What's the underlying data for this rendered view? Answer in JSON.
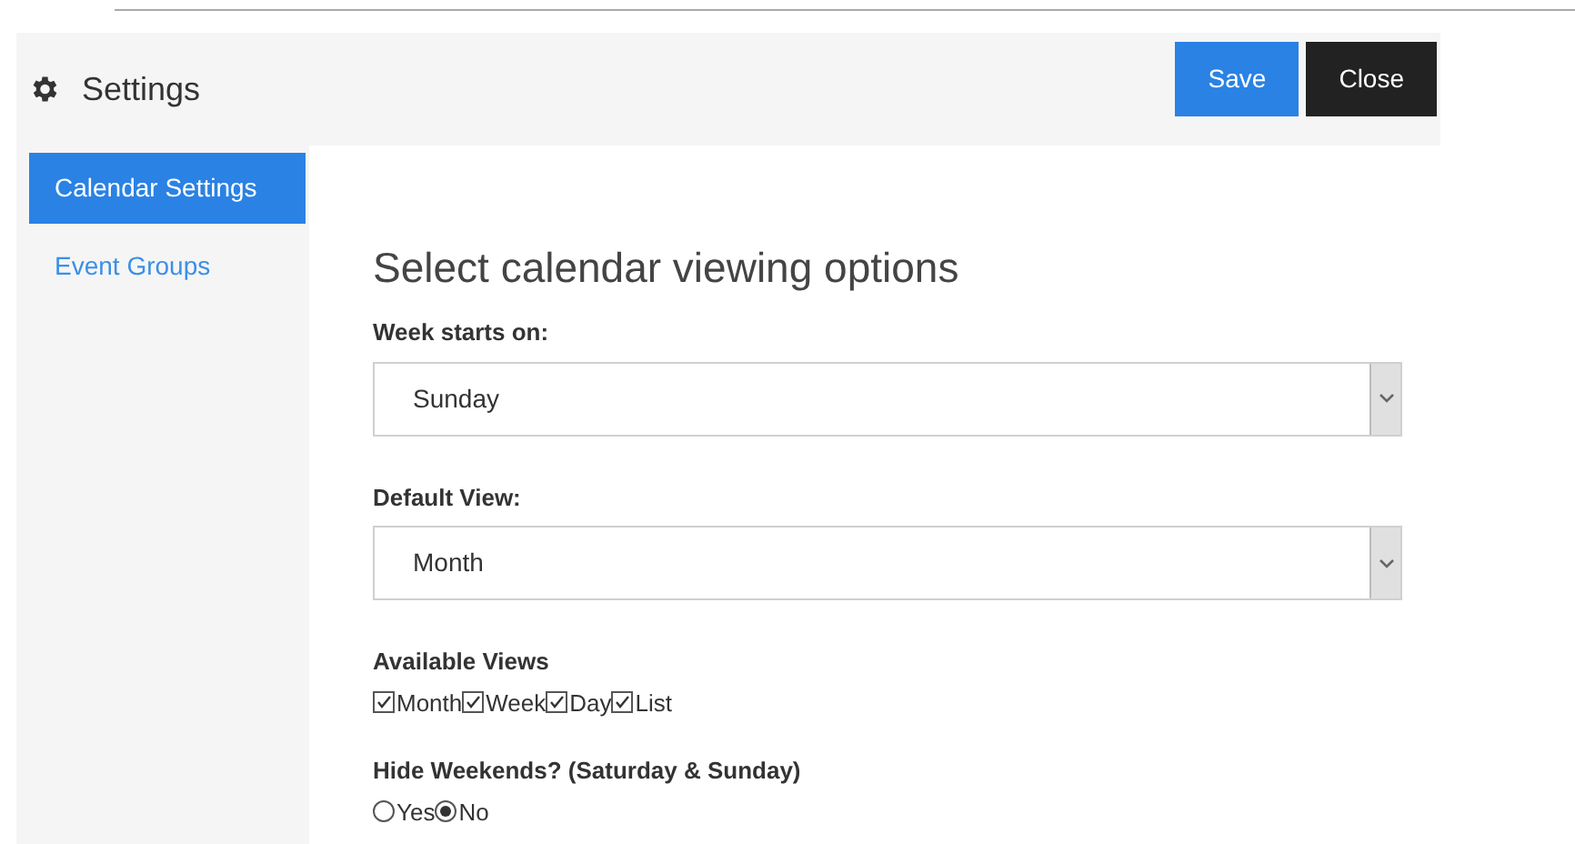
{
  "header": {
    "title": "Settings",
    "buttons": [
      {
        "label": "Save",
        "kind": "primary"
      },
      {
        "label": "Close",
        "kind": "dark"
      }
    ]
  },
  "sidebar": {
    "items": [
      {
        "label": "Calendar Settings",
        "selected": true
      },
      {
        "label": "Event Groups",
        "selected": false
      }
    ]
  },
  "content": {
    "heading": "Select calendar viewing options",
    "selects": [
      {
        "label": "Week starts on:",
        "value": "Sunday"
      },
      {
        "label": "Default View:",
        "value": "Month"
      }
    ],
    "available_views": {
      "label": "Available Views",
      "options": [
        {
          "label": "Month",
          "checked": true
        },
        {
          "label": "Week",
          "checked": true
        },
        {
          "label": "Day",
          "checked": true
        },
        {
          "label": "List",
          "checked": true
        }
      ]
    },
    "hide_weekends": {
      "label": "Hide Weekends? (Saturday & Sunday)",
      "options": [
        {
          "label": "Yes",
          "selected": false
        },
        {
          "label": "No",
          "selected": true
        }
      ]
    }
  }
}
